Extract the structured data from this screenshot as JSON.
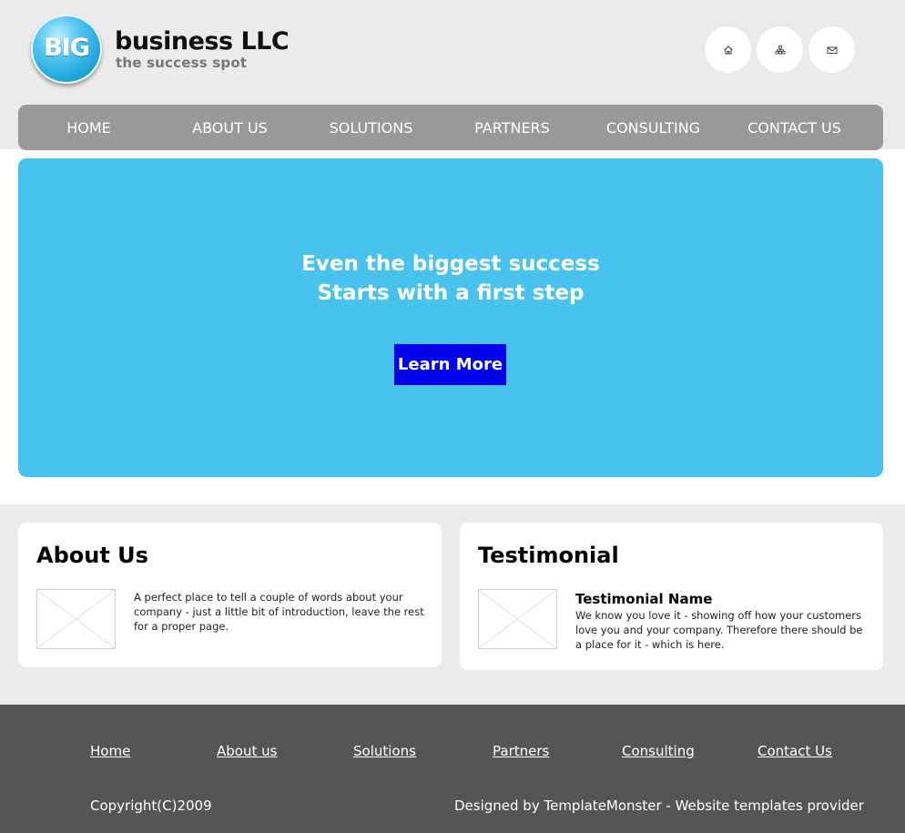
{
  "brand": {
    "badge": "BIG",
    "name": "business LLC",
    "slogan": "the success spot"
  },
  "top_icons": [
    {
      "name": "home-icon",
      "icon": "home"
    },
    {
      "name": "sitemap-icon",
      "icon": "sitemap"
    },
    {
      "name": "mail-icon",
      "icon": "mail"
    }
  ],
  "nav": {
    "items": [
      {
        "label": "HOME"
      },
      {
        "label": "ABOUT US"
      },
      {
        "label": "SOLUTIONS"
      },
      {
        "label": "PARTNERS"
      },
      {
        "label": "CONSULTING"
      },
      {
        "label": "CONTACT US"
      }
    ]
  },
  "hero": {
    "line1": "Even the biggest success",
    "line2": "Starts with a first step",
    "button": "Learn More"
  },
  "about": {
    "title": "About Us",
    "text": "A perfect place to tell a couple of words about your company - just a little bit of introduction, leave the rest for a proper page."
  },
  "testimonial": {
    "title": "Testimonial",
    "name": "Testimonial Name",
    "text": "We know you love it - showing off how your customers love you and your company. Therefore there should be a place for it - which is here."
  },
  "footer": {
    "links": [
      {
        "label": "Home"
      },
      {
        "label": "About us"
      },
      {
        "label": "Solutions"
      },
      {
        "label": "Partners"
      },
      {
        "label": "Consulting"
      },
      {
        "label": "Contact Us"
      }
    ],
    "copyright": "Copyright(C)2009",
    "credit": "Designed by TemplateMonster - Website templates provider"
  },
  "colors": {
    "header_bg": "#ebebeb",
    "nav_bg": "#999999",
    "hero_bg": "#47c3ed",
    "button_bg": "#0000ee",
    "footer_bg": "#555555"
  }
}
